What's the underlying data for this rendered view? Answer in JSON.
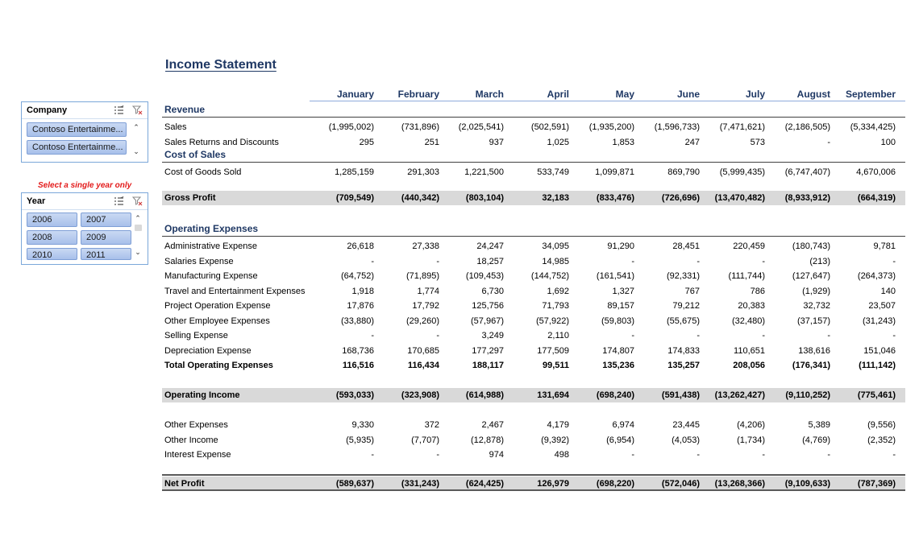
{
  "title": "Income Statement",
  "slicers": {
    "company": {
      "header": "Company",
      "items": [
        "Contoso Entertainme...",
        "Contoso Entertainme..."
      ]
    },
    "note": "Select a single year only",
    "year": {
      "header": "Year",
      "items": [
        "2006",
        "2007",
        "2008",
        "2009",
        "2010",
        "2011"
      ]
    }
  },
  "months": [
    "January",
    "February",
    "March",
    "April",
    "May",
    "June",
    "July",
    "August",
    "September"
  ],
  "sections": {
    "revenue": "Revenue",
    "cost_of_sales": "Cost of Sales",
    "operating_expenses": "Operating Expenses"
  },
  "rows": {
    "sales": {
      "label": "Sales",
      "values": [
        "(1,995,002)",
        "(731,896)",
        "(2,025,541)",
        "(502,591)",
        "(1,935,200)",
        "(1,596,733)",
        "(7,471,621)",
        "(2,186,505)",
        "(5,334,425)"
      ]
    },
    "returns": {
      "label": "Sales Returns and Discounts",
      "values": [
        "295",
        "251",
        "937",
        "1,025",
        "1,853",
        "247",
        "573",
        "-",
        "100"
      ]
    },
    "cogs": {
      "label": "Cost of Goods Sold",
      "values": [
        "1,285,159",
        "291,303",
        "1,221,500",
        "533,749",
        "1,099,871",
        "869,790",
        "(5,999,435)",
        "(6,747,407)",
        "4,670,006"
      ]
    },
    "gross_profit": {
      "label": "Gross Profit",
      "values": [
        "(709,549)",
        "(440,342)",
        "(803,104)",
        "32,183",
        "(833,476)",
        "(726,696)",
        "(13,470,482)",
        "(8,933,912)",
        "(664,319)"
      ]
    },
    "admin": {
      "label": "Administrative Expense",
      "values": [
        "26,618",
        "27,338",
        "24,247",
        "34,095",
        "91,290",
        "28,451",
        "220,459",
        "(180,743)",
        "9,781"
      ]
    },
    "salaries": {
      "label": "Salaries Expense",
      "values": [
        "-",
        "-",
        "18,257",
        "14,985",
        "-",
        "-",
        "-",
        "(213)",
        "-"
      ]
    },
    "manufacturing": {
      "label": "Manufacturing Expense",
      "values": [
        "(64,752)",
        "(71,895)",
        "(109,453)",
        "(144,752)",
        "(161,541)",
        "(92,331)",
        "(111,744)",
        "(127,647)",
        "(264,373)"
      ]
    },
    "travel": {
      "label": "Travel and Entertainment Expenses",
      "values": [
        "1,918",
        "1,774",
        "6,730",
        "1,692",
        "1,327",
        "767",
        "786",
        "(1,929)",
        "140"
      ]
    },
    "project": {
      "label": "Project Operation Expense",
      "values": [
        "17,876",
        "17,792",
        "125,756",
        "71,793",
        "89,157",
        "79,212",
        "20,383",
        "32,732",
        "23,507"
      ]
    },
    "other_employee": {
      "label": "Other Employee Expenses",
      "values": [
        "(33,880)",
        "(29,260)",
        "(57,967)",
        "(57,922)",
        "(59,803)",
        "(55,675)",
        "(32,480)",
        "(37,157)",
        "(31,243)"
      ]
    },
    "selling": {
      "label": "Selling Expense",
      "values": [
        "-",
        "-",
        "3,249",
        "2,110",
        "-",
        "-",
        "-",
        "-",
        "-"
      ]
    },
    "depreciation": {
      "label": "Depreciation Expense",
      "values": [
        "168,736",
        "170,685",
        "177,297",
        "177,509",
        "174,807",
        "174,833",
        "110,651",
        "138,616",
        "151,046"
      ]
    },
    "total_opex": {
      "label": "Total Operating Expenses",
      "values": [
        "116,516",
        "116,434",
        "188,117",
        "99,511",
        "135,236",
        "135,257",
        "208,056",
        "(176,341)",
        "(111,142)"
      ]
    },
    "operating_income": {
      "label": "Operating Income",
      "values": [
        "(593,033)",
        "(323,908)",
        "(614,988)",
        "131,694",
        "(698,240)",
        "(591,438)",
        "(13,262,427)",
        "(9,110,252)",
        "(775,461)"
      ]
    },
    "other_expenses": {
      "label": "Other Expenses",
      "values": [
        "9,330",
        "372",
        "2,467",
        "4,179",
        "6,974",
        "23,445",
        "(4,206)",
        "5,389",
        "(9,556)"
      ]
    },
    "other_income": {
      "label": "Other Income",
      "values": [
        "(5,935)",
        "(7,707)",
        "(12,878)",
        "(9,392)",
        "(6,954)",
        "(4,053)",
        "(1,734)",
        "(4,769)",
        "(2,352)"
      ]
    },
    "interest": {
      "label": "Interest Expense",
      "values": [
        "-",
        "-",
        "974",
        "498",
        "-",
        "-",
        "-",
        "-",
        "-"
      ]
    },
    "net_profit": {
      "label": "Net Profit",
      "values": [
        "(589,637)",
        "(331,243)",
        "(624,425)",
        "126,979",
        "(698,220)",
        "(572,046)",
        "(13,268,366)",
        "(9,109,633)",
        "(787,369)"
      ]
    }
  }
}
